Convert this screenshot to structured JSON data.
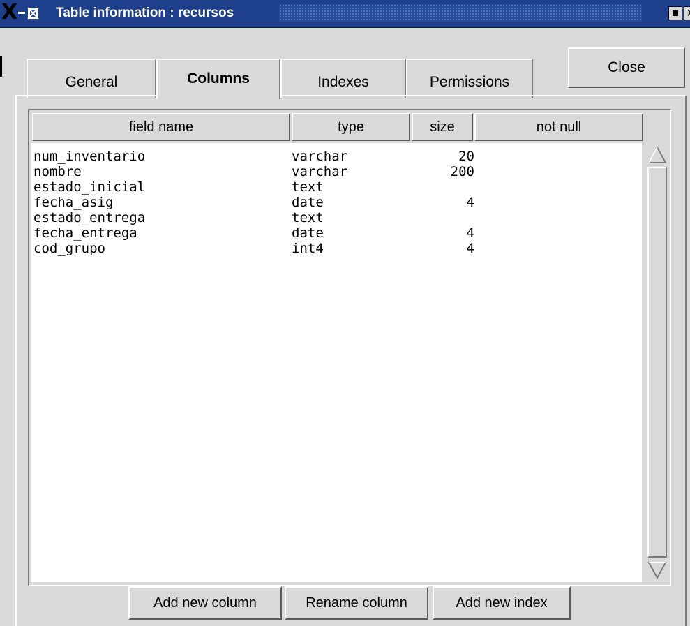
{
  "window": {
    "title": "Table information : recursos",
    "title_bar_color": "#1e3f8c",
    "icons": [
      "x-logo-icon",
      "table-icon",
      "minimize-icon",
      "close-icon"
    ]
  },
  "tabs": [
    {
      "label": "General",
      "active": false
    },
    {
      "label": "Columns",
      "active": true
    },
    {
      "label": "Indexes",
      "active": false
    },
    {
      "label": "Permissions",
      "active": false
    }
  ],
  "close_button": "Close",
  "table": {
    "headers": [
      "field name",
      "type",
      "size",
      "not null"
    ],
    "rows": [
      {
        "name": "num_inventario",
        "type": "varchar",
        "size": "20",
        "not_null": ""
      },
      {
        "name": "nombre",
        "type": "varchar",
        "size": "200",
        "not_null": ""
      },
      {
        "name": "estado_inicial",
        "type": "text",
        "size": "",
        "not_null": ""
      },
      {
        "name": "fecha_asig",
        "type": "date",
        "size": "4",
        "not_null": ""
      },
      {
        "name": "estado_entrega",
        "type": "text",
        "size": "",
        "not_null": ""
      },
      {
        "name": "fecha_entrega",
        "type": "date",
        "size": "4",
        "not_null": ""
      },
      {
        "name": "cod_grupo",
        "type": "int4",
        "size": "4",
        "not_null": ""
      }
    ]
  },
  "buttons": {
    "add_column": "Add new column",
    "rename_column": "Rename column",
    "add_index": "Add new index"
  }
}
